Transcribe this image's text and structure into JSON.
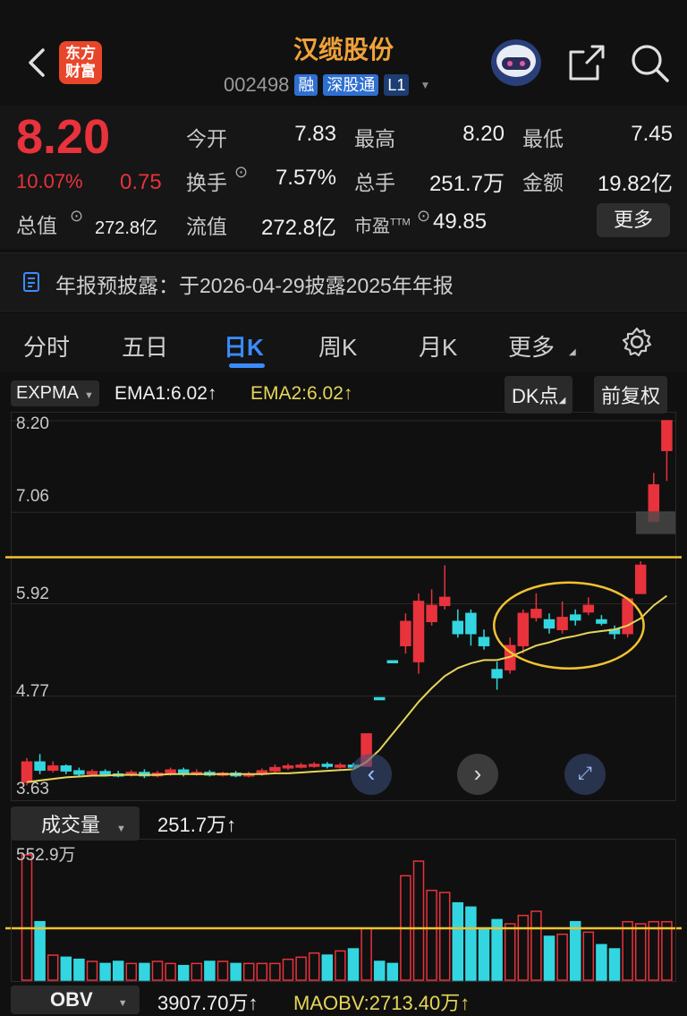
{
  "header": {
    "title": "汉缆股份",
    "code": "002498",
    "tags": [
      "融",
      "深股通",
      "L1"
    ],
    "logo_line1": "东方",
    "logo_line2": "财富"
  },
  "quote": {
    "price": "8.20",
    "pct": "10.07%",
    "change": "0.75",
    "total_value_label": "总值",
    "total_value": "272.8亿",
    "open_label": "今开",
    "open": "7.83",
    "high_label": "最高",
    "high": "8.20",
    "low_label": "最低",
    "low": "7.45",
    "turnover_label": "换手",
    "turnover": "7.57%",
    "volume_label": "总手",
    "volume": "251.7万",
    "amount_label": "金额",
    "amount": "19.82亿",
    "float_label": "流值",
    "float_value": "272.8亿",
    "pe_label": "市盈",
    "pe_suffix": "TTM",
    "pe": "49.85",
    "more_label": "更多"
  },
  "notice": {
    "text": "年报预披露：于2026-04-29披露2025年年报"
  },
  "tabs": [
    "分时",
    "五日",
    "日K",
    "周K",
    "月K",
    "更多"
  ],
  "active_tab": "日K",
  "indicator": {
    "name": "EXPMA",
    "ema1": "EMA1:6.02",
    "ema1_arrow": "↑",
    "ema2": "EMA2:6.02",
    "ema2_arrow": "↑",
    "dk": "DK点",
    "adj": "前复权"
  },
  "volume_panel": {
    "name": "成交量",
    "value": "251.7万",
    "arrow": "↑",
    "max_label": "552.9万"
  },
  "obv_panel": {
    "name": "OBV",
    "value": "3907.70万",
    "arrow": "↑",
    "maobv": "MAOBV:2713.40万",
    "maobv_arrow": "↑"
  },
  "chart_data": {
    "type": "candlestick",
    "y_ticks": [
      "8.20",
      "7.06",
      "5.92",
      "4.77",
      "3.63"
    ],
    "ylim": [
      3.63,
      8.2
    ],
    "colors": {
      "up": "#e8323c",
      "down": "#33d6e0",
      "ema": "#e6d55a",
      "resistance": "#f2c230"
    },
    "candles": [
      {
        "o": 3.7,
        "c": 3.95,
        "h": 4.0,
        "l": 3.66
      },
      {
        "o": 3.95,
        "c": 3.85,
        "h": 4.05,
        "l": 3.8
      },
      {
        "o": 3.85,
        "c": 3.9,
        "h": 3.96,
        "l": 3.82
      },
      {
        "o": 3.9,
        "c": 3.84,
        "h": 3.92,
        "l": 3.8
      },
      {
        "o": 3.84,
        "c": 3.8,
        "h": 3.88,
        "l": 3.76
      },
      {
        "o": 3.8,
        "c": 3.83,
        "h": 3.86,
        "l": 3.77
      },
      {
        "o": 3.83,
        "c": 3.8,
        "h": 3.86,
        "l": 3.78
      },
      {
        "o": 3.8,
        "c": 3.79,
        "h": 3.84,
        "l": 3.76
      },
      {
        "o": 3.79,
        "c": 3.82,
        "h": 3.85,
        "l": 3.77
      },
      {
        "o": 3.82,
        "c": 3.78,
        "h": 3.86,
        "l": 3.75
      },
      {
        "o": 3.78,
        "c": 3.81,
        "h": 3.84,
        "l": 3.76
      },
      {
        "o": 3.81,
        "c": 3.85,
        "h": 3.88,
        "l": 3.78
      },
      {
        "o": 3.85,
        "c": 3.8,
        "h": 3.88,
        "l": 3.77
      },
      {
        "o": 3.8,
        "c": 3.82,
        "h": 3.86,
        "l": 3.78
      },
      {
        "o": 3.82,
        "c": 3.79,
        "h": 3.85,
        "l": 3.77
      },
      {
        "o": 3.79,
        "c": 3.81,
        "h": 3.83,
        "l": 3.77
      },
      {
        "o": 3.81,
        "c": 3.78,
        "h": 3.84,
        "l": 3.76
      },
      {
        "o": 3.78,
        "c": 3.8,
        "h": 3.83,
        "l": 3.76
      },
      {
        "o": 3.8,
        "c": 3.84,
        "h": 3.87,
        "l": 3.78
      },
      {
        "o": 3.84,
        "c": 3.88,
        "h": 3.92,
        "l": 3.82
      },
      {
        "o": 3.88,
        "c": 3.9,
        "h": 3.93,
        "l": 3.85
      },
      {
        "o": 3.9,
        "c": 3.91,
        "h": 3.94,
        "l": 3.87
      },
      {
        "o": 3.91,
        "c": 3.92,
        "h": 3.95,
        "l": 3.88
      },
      {
        "o": 3.92,
        "c": 3.9,
        "h": 3.95,
        "l": 3.87
      },
      {
        "o": 3.9,
        "c": 3.91,
        "h": 3.94,
        "l": 3.87
      },
      {
        "o": 3.91,
        "c": 3.9,
        "h": 3.94,
        "l": 3.88
      },
      {
        "o": 3.9,
        "c": 4.3,
        "h": 4.3,
        "l": 3.9
      },
      {
        "o": 4.75,
        "c": 4.73,
        "h": 4.75,
        "l": 4.73
      },
      {
        "o": 5.21,
        "c": 5.19,
        "h": 5.21,
        "l": 5.19
      },
      {
        "o": 5.4,
        "c": 5.7,
        "h": 5.8,
        "l": 5.3
      },
      {
        "o": 5.2,
        "c": 5.95,
        "h": 6.05,
        "l": 5.05
      },
      {
        "o": 5.7,
        "c": 5.9,
        "h": 6.1,
        "l": 5.65
      },
      {
        "o": 5.9,
        "c": 6.0,
        "h": 6.4,
        "l": 5.85
      },
      {
        "o": 5.7,
        "c": 5.55,
        "h": 5.85,
        "l": 5.5
      },
      {
        "o": 5.8,
        "c": 5.55,
        "h": 5.85,
        "l": 5.4
      },
      {
        "o": 5.5,
        "c": 5.4,
        "h": 5.6,
        "l": 5.35
      },
      {
        "o": 5.1,
        "c": 5.0,
        "h": 5.2,
        "l": 4.85
      },
      {
        "o": 5.1,
        "c": 5.4,
        "h": 5.5,
        "l": 5.05
      },
      {
        "o": 5.4,
        "c": 5.8,
        "h": 5.85,
        "l": 5.3
      },
      {
        "o": 5.75,
        "c": 5.85,
        "h": 6.05,
        "l": 5.7
      },
      {
        "o": 5.72,
        "c": 5.62,
        "h": 5.8,
        "l": 5.55
      },
      {
        "o": 5.6,
        "c": 5.75,
        "h": 5.95,
        "l": 5.55
      },
      {
        "o": 5.78,
        "c": 5.72,
        "h": 5.85,
        "l": 5.65
      },
      {
        "o": 5.82,
        "c": 5.9,
        "h": 6.0,
        "l": 5.78
      },
      {
        "o": 5.72,
        "c": 5.68,
        "h": 5.78,
        "l": 5.65
      },
      {
        "o": 5.6,
        "c": 5.55,
        "h": 5.65,
        "l": 5.48
      },
      {
        "o": 5.55,
        "c": 5.98,
        "h": 6.0,
        "l": 5.5
      },
      {
        "o": 6.05,
        "c": 6.4,
        "h": 6.45,
        "l": 6.05
      },
      {
        "o": 6.95,
        "c": 7.4,
        "h": 7.55,
        "l": 6.95
      },
      {
        "o": 7.83,
        "c": 8.2,
        "h": 8.2,
        "l": 7.45
      }
    ],
    "ema": [
      3.7,
      3.72,
      3.74,
      3.76,
      3.77,
      3.78,
      3.78,
      3.79,
      3.79,
      3.79,
      3.79,
      3.8,
      3.8,
      3.8,
      3.8,
      3.8,
      3.8,
      3.8,
      3.8,
      3.81,
      3.81,
      3.82,
      3.83,
      3.84,
      3.85,
      3.86,
      3.95,
      4.1,
      4.3,
      4.5,
      4.7,
      4.87,
      5.02,
      5.12,
      5.18,
      5.22,
      5.22,
      5.26,
      5.33,
      5.4,
      5.44,
      5.49,
      5.52,
      5.56,
      5.58,
      5.6,
      5.65,
      5.74,
      5.9,
      6.02
    ],
    "resistance_level": 6.5,
    "volumes": [
      60,
      28,
      12,
      11,
      10,
      9,
      8,
      9,
      8,
      8,
      9,
      8,
      7,
      8,
      9,
      9,
      8,
      8,
      8,
      8,
      10,
      11,
      13,
      12,
      14,
      15,
      25,
      9,
      8,
      50,
      57,
      43,
      42,
      37,
      35,
      25,
      29,
      27,
      31,
      33,
      21,
      22,
      28,
      23,
      17,
      15,
      28,
      27,
      28,
      28
    ]
  }
}
